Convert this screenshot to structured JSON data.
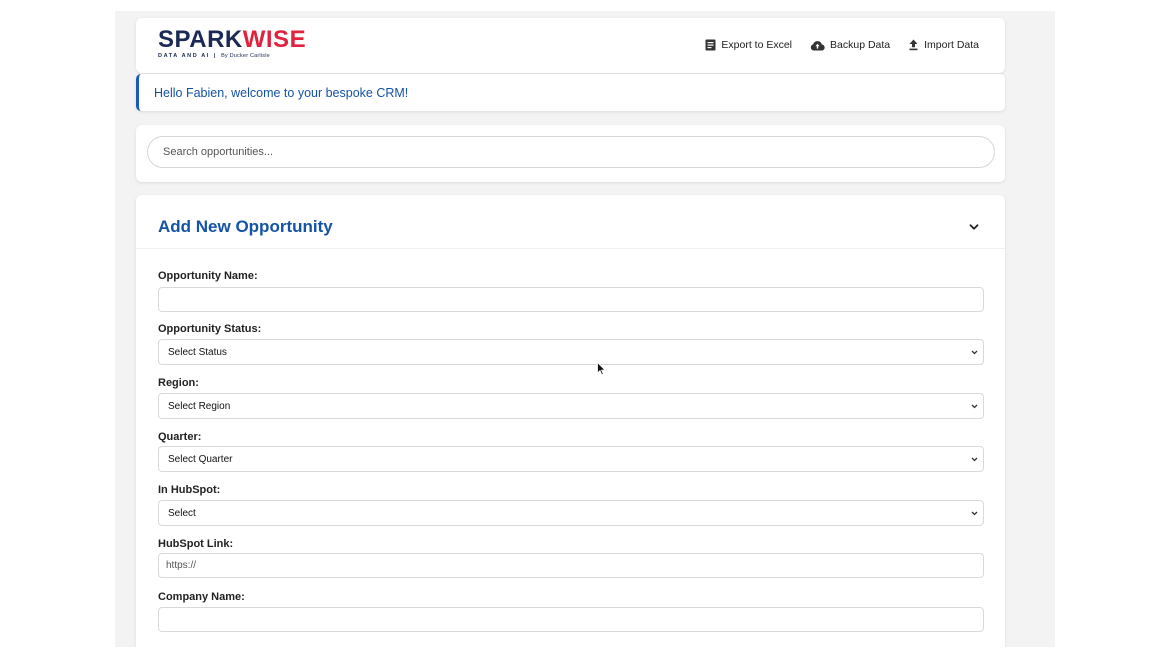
{
  "brand": {
    "name_part1": "SPARK",
    "name_part2": "WISE",
    "tagline": "DATA AND AI",
    "byline": "By Ducker Carlisle",
    "color_primary": "#1b2a55",
    "color_accent": "#e0233e"
  },
  "header": {
    "actions": [
      {
        "label": "Export to Excel",
        "icon": "spreadsheet-icon"
      },
      {
        "label": "Backup Data",
        "icon": "cloud-upload-icon"
      },
      {
        "label": "Import Data",
        "icon": "upload-icon"
      }
    ]
  },
  "welcome": {
    "message": "Hello Fabien, welcome to your bespoke CRM!"
  },
  "search": {
    "placeholder": "Search opportunities..."
  },
  "form": {
    "title": "Add New Opportunity",
    "toggle_icon": "chevron-down-icon",
    "fields": {
      "opportunity_name": {
        "label": "Opportunity Name:",
        "value": ""
      },
      "opportunity_status": {
        "label": "Opportunity Status:",
        "selected": "Select Status"
      },
      "region": {
        "label": "Region:",
        "selected": "Select Region"
      },
      "quarter": {
        "label": "Quarter:",
        "selected": "Select Quarter"
      },
      "in_hubspot": {
        "label": "In HubSpot:",
        "selected": "Select"
      },
      "hubspot_link": {
        "label": "HubSpot Link:",
        "placeholder": "https://"
      },
      "company_name": {
        "label": "Company Name:",
        "value": ""
      }
    }
  },
  "colors": {
    "accent_blue": "#1553a6",
    "background": "#f3f3f3"
  }
}
